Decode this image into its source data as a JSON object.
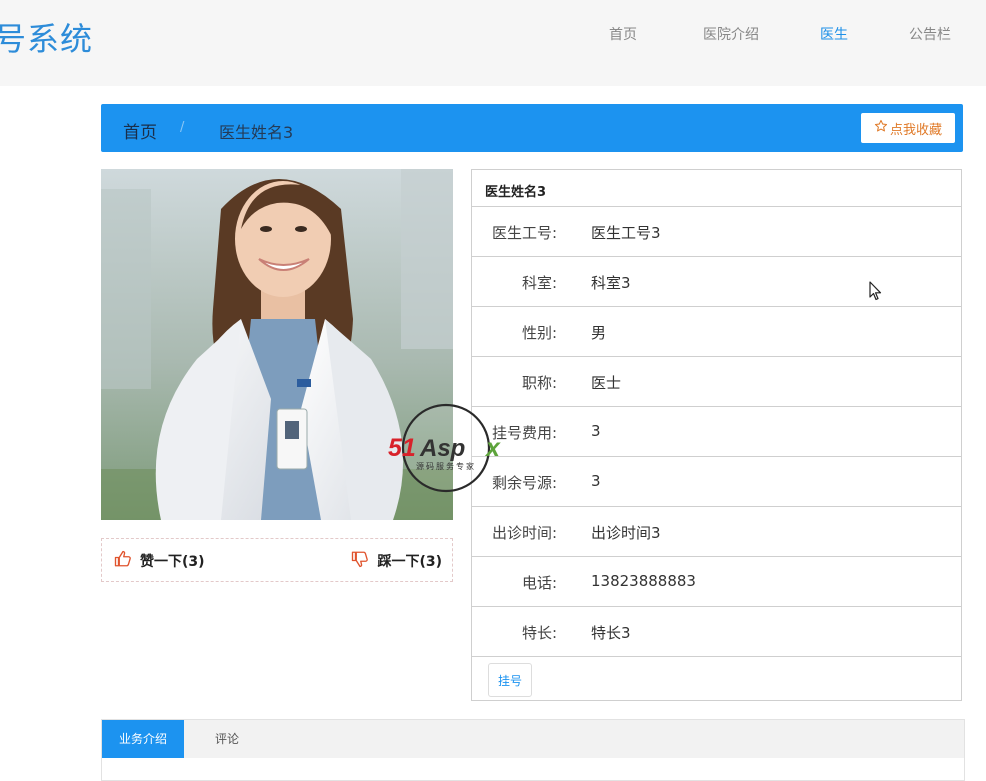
{
  "header": {
    "brand": "号系统",
    "nav": [
      "首页",
      "医院介绍",
      "医生",
      "公告栏"
    ],
    "active_nav": "医生"
  },
  "breadcrumb": {
    "home": "首页",
    "separator": "/",
    "current": "医生姓名3",
    "favorite_label": "点我收藏",
    "favorite_icon": "star-outline-icon"
  },
  "vote": {
    "like_label": "赞一下(3)",
    "dislike_label": "踩一下(3)",
    "like_icon": "thumbs-up-icon",
    "dislike_icon": "thumbs-down-icon"
  },
  "doctor": {
    "name": "医生姓名3",
    "fields": [
      {
        "label": "医生工号:",
        "value": "医生工号3"
      },
      {
        "label": "科室:",
        "value": "科室3"
      },
      {
        "label": "性别:",
        "value": "男"
      },
      {
        "label": "职称:",
        "value": "医士"
      },
      {
        "label": "挂号费用:",
        "value": "3"
      },
      {
        "label": "剩余号源:",
        "value": "3"
      },
      {
        "label": "出诊时间:",
        "value": "出诊时间3"
      },
      {
        "label": "电话:",
        "value": "13823888883"
      },
      {
        "label": "特长:",
        "value": "特长3"
      }
    ],
    "book_label": "挂号"
  },
  "tabs": [
    "业务介绍",
    "评论"
  ],
  "watermark": {
    "logo": "51Aspx",
    "tagline": "源码服务专家"
  },
  "colors": {
    "accent": "#1c93f0",
    "favorite": "#e07a28",
    "like": "#e0542e"
  }
}
